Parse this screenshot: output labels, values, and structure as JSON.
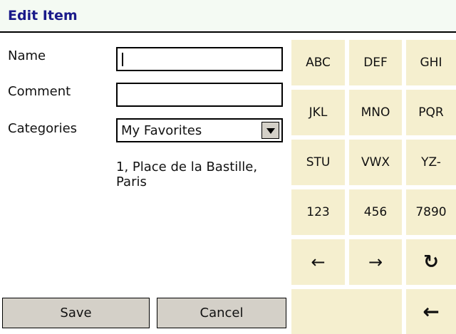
{
  "title": "Edit Item",
  "form": {
    "name_label": "Name",
    "name_value": "",
    "comment_label": "Comment",
    "comment_value": "",
    "categories_label": "Categories",
    "category_selected": "My Favorites",
    "address_line1": "1, Place de la Bastille,",
    "address_line2": "Paris"
  },
  "keypad": {
    "keys": [
      "ABC",
      "DEF",
      "GHI",
      "JKL",
      "MNO",
      "PQR",
      "STU",
      "VWX",
      "YZ-",
      "123",
      "456",
      "7890"
    ],
    "arrows": [
      "←",
      "→",
      "↻"
    ],
    "backspace": "←",
    "key_color": "#f5efcf"
  },
  "buttons": {
    "save": "Save",
    "cancel": "Cancel"
  }
}
